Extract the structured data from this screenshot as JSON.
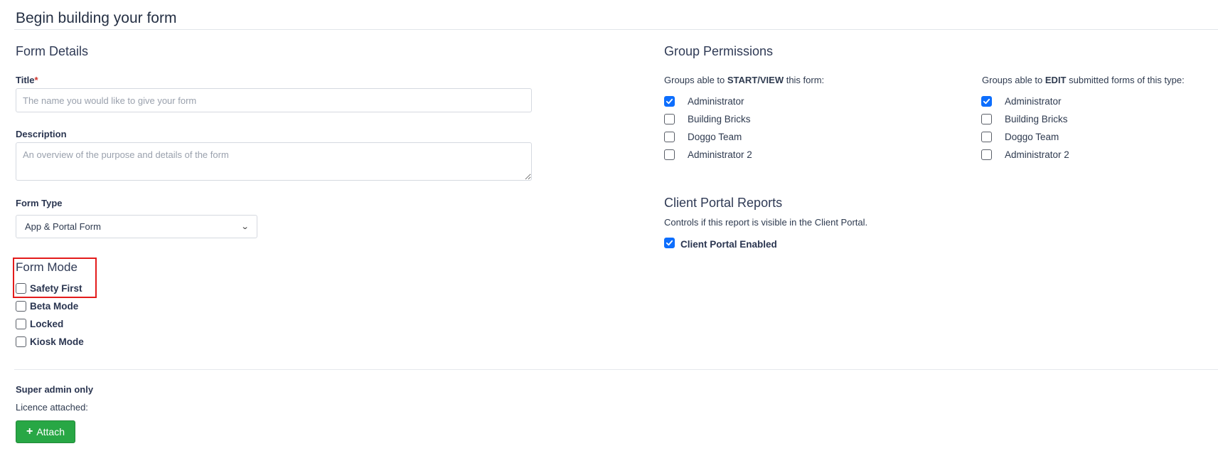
{
  "page": {
    "title": "Begin building your form"
  },
  "form_details": {
    "heading": "Form Details",
    "title_label": "Title",
    "required_mark": "*",
    "title_placeholder": "The name you would like to give your form",
    "title_value": "",
    "description_label": "Description",
    "description_placeholder": "An overview of the purpose and details of the form",
    "description_value": "",
    "form_type_label": "Form Type",
    "form_type_selected": "App & Portal Form"
  },
  "form_mode": {
    "heading": "Form Mode",
    "options": [
      {
        "label": "Safety First",
        "checked": false
      },
      {
        "label": "Beta Mode",
        "checked": false
      },
      {
        "label": "Locked",
        "checked": false
      },
      {
        "label": "Kiosk Mode",
        "checked": false
      }
    ]
  },
  "group_permissions": {
    "heading": "Group Permissions",
    "start_view": {
      "prefix": "Groups able to ",
      "emphasis": "START/VIEW",
      "suffix": " this form:",
      "groups": [
        {
          "label": "Administrator",
          "checked": true
        },
        {
          "label": "Building Bricks",
          "checked": false
        },
        {
          "label": "Doggo Team",
          "checked": false
        },
        {
          "label": "Administrator 2",
          "checked": false
        }
      ]
    },
    "edit": {
      "prefix": "Groups able to ",
      "emphasis": "EDIT",
      "suffix": " submitted forms of this type:",
      "groups": [
        {
          "label": "Administrator",
          "checked": true
        },
        {
          "label": "Building Bricks",
          "checked": false
        },
        {
          "label": "Doggo Team",
          "checked": false
        },
        {
          "label": "Administrator 2",
          "checked": false
        }
      ]
    }
  },
  "client_portal": {
    "heading": "Client Portal Reports",
    "description": "Controls if this report is visible in the Client Portal.",
    "enabled_label": "Client Portal Enabled",
    "enabled": true
  },
  "super_admin": {
    "heading": "Super admin only",
    "licence_label": "Licence attached:",
    "attach_label": "Attach",
    "attach_icon": "plus-icon"
  },
  "colors": {
    "checkbox_checked": "#0d6efd",
    "attach_button": "#28a745",
    "highlight_border": "#e31b1b",
    "required": "#d0342c"
  }
}
